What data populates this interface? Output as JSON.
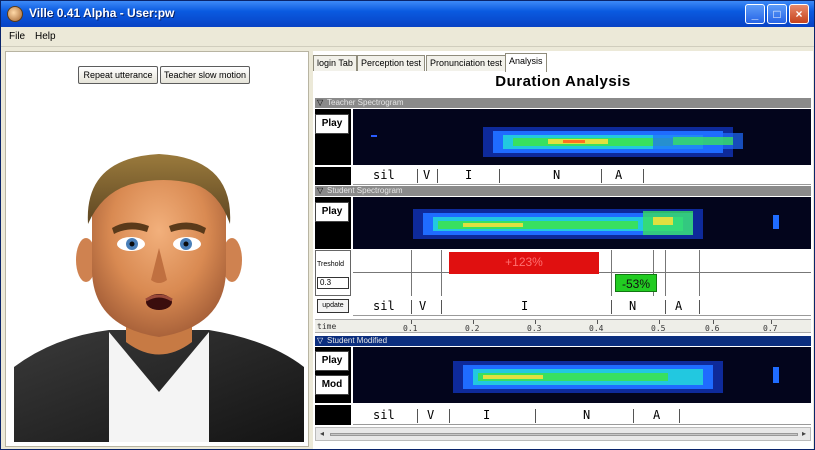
{
  "window": {
    "title": "Ville 0.41 Alpha - User:pw",
    "controls": {
      "minimize": "_",
      "maximize": "□",
      "close": "×"
    }
  },
  "menu": {
    "file": "File",
    "help": "Help"
  },
  "left": {
    "repeat_button": "Repeat utterance",
    "slow_button": "Teacher slow motion"
  },
  "tabs": [
    {
      "label": "login Tab",
      "active": false
    },
    {
      "label": "Perception test",
      "active": false
    },
    {
      "label": "Pronunciation test",
      "active": false
    },
    {
      "label": "Analysis",
      "active": true
    }
  ],
  "analysis": {
    "heading": "Duration Analysis",
    "teacher": {
      "section_label": "Teacher Spectrogram",
      "play_label": "Play",
      "segments": [
        "sil",
        "V",
        "I",
        "N",
        "A"
      ]
    },
    "student": {
      "section_label": "Student Spectrogram",
      "play_label": "Play",
      "threshold_label": "Treshold",
      "threshold_value": "0.3",
      "update_label": "update",
      "diff_I": "+123%",
      "diff_N": "-53%",
      "segments": [
        "sil",
        "V",
        "I",
        "N",
        "A"
      ]
    },
    "time_axis": {
      "label": "time",
      "ticks": [
        "0.1",
        "0.2",
        "0.3",
        "0.4",
        "0.5",
        "0.6",
        "0.7"
      ]
    },
    "modified": {
      "section_label": "Student Modified",
      "play_label": "Play",
      "mod_label": "Mod",
      "segments": [
        "sil",
        "V",
        "I",
        "N",
        "A"
      ]
    }
  },
  "colors": {
    "title_bar": "#0a5ae0",
    "increase": "#e01010",
    "decrease": "#22cc22",
    "section_gray": "#8a8a8a",
    "section_navy": "#0b2e7e"
  }
}
